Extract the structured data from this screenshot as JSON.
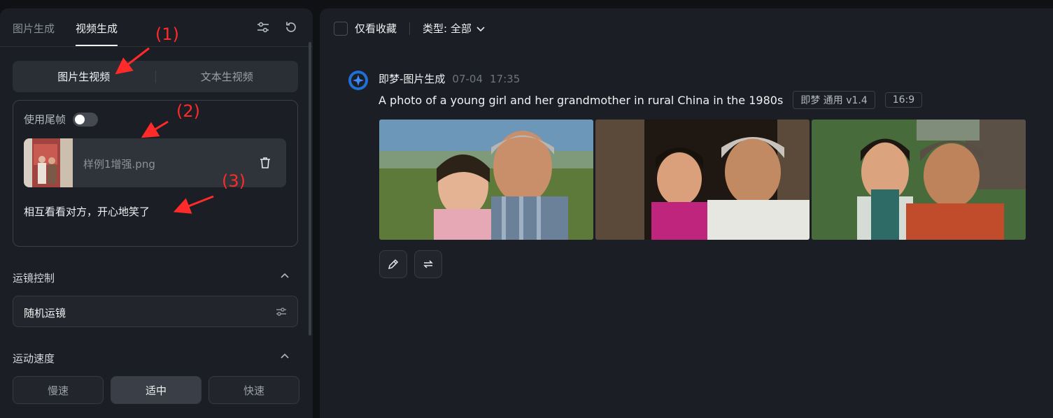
{
  "left": {
    "tabs": [
      {
        "label": "图片生成"
      },
      {
        "label": "视频生成"
      }
    ],
    "mode": {
      "options": [
        {
          "label": "图片生视频"
        },
        {
          "label": "文本生视频"
        }
      ]
    },
    "tail_frame_label": "使用尾帧",
    "file_name": "样例1增强.png",
    "prompt": "相互看看对方，开心地笑了",
    "camera_section": "运镜控制",
    "camera_value": "随机运镜",
    "speed_section": "运动速度",
    "speed_options": [
      {
        "label": "慢速"
      },
      {
        "label": "适中"
      },
      {
        "label": "快速"
      }
    ]
  },
  "main": {
    "fav_label": "仅看收藏",
    "type_label": "类型: 全部",
    "message": {
      "source": "即梦-图片生成",
      "date": "07-04",
      "time": "17:35",
      "prompt": "A photo of a young girl and her grandmother in rural China in the 1980s",
      "badges": [
        "即梦 通用 v1.4",
        "16:9"
      ]
    }
  },
  "annotations": [
    "(1)",
    "(2)",
    "(3)"
  ],
  "colors": {
    "annotation": "#ff2a2a",
    "background": "#1b1e24",
    "accent": "#3d8bfd"
  }
}
